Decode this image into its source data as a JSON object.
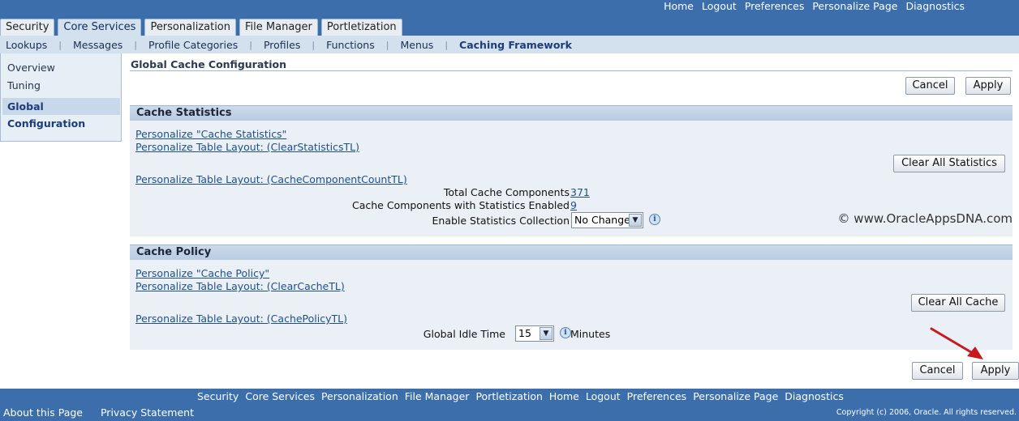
{
  "global_links": [
    "Home",
    "Logout",
    "Preferences",
    "Personalize Page",
    "Diagnostics"
  ],
  "tabs": [
    {
      "label": "Security",
      "active": false
    },
    {
      "label": "Core Services",
      "active": true
    },
    {
      "label": "Personalization",
      "active": false
    },
    {
      "label": "File Manager",
      "active": false
    },
    {
      "label": "Portletization",
      "active": false
    }
  ],
  "subnav": [
    "Lookups",
    "Messages",
    "Profile Categories",
    "Profiles",
    "Functions",
    "Menus",
    "Caching Framework"
  ],
  "subnav_active": "Caching Framework",
  "sidenav": [
    "Overview",
    "Tuning",
    "Global Configuration"
  ],
  "page_title": "Global Cache Configuration",
  "buttons": {
    "cancel": "Cancel",
    "apply": "Apply",
    "clear_all_statistics": "Clear All Statistics",
    "clear_all_cache": "Clear All Cache"
  },
  "cache_statistics": {
    "header": "Cache Statistics",
    "link1": "Personalize \"Cache Statistics\"",
    "link2": "Personalize Table Layout: (ClearStatisticsTL)",
    "link3": "Personalize Table Layout: (CacheComponentCountTL)",
    "total_label": "Total Cache Components",
    "total_value": "371",
    "enabled_label": "Cache Components with Statistics Enabled",
    "enabled_value": "9",
    "collection_label": "Enable Statistics Collection",
    "collection_value": "No Change"
  },
  "cache_policy": {
    "header": "Cache Policy",
    "link1": "Personalize \"Cache Policy\"",
    "link2": "Personalize Table Layout: (ClearCacheTL)",
    "link3": "Personalize Table Layout: (CachePolicyTL)",
    "idle_label": "Global Idle Time",
    "idle_value": "15",
    "idle_unit": "Minutes"
  },
  "watermark": "© www.OracleAppsDNA.com",
  "footer_links": [
    "Security",
    "Core Services",
    "Personalization",
    "File Manager",
    "Portletization",
    "Home",
    "Logout",
    "Preferences",
    "Personalize Page",
    "Diagnostics"
  ],
  "footer_bottom_links": [
    "About this Page",
    "Privacy Statement"
  ],
  "copyright": "Copyright (c) 2006, Oracle. All rights reserved."
}
